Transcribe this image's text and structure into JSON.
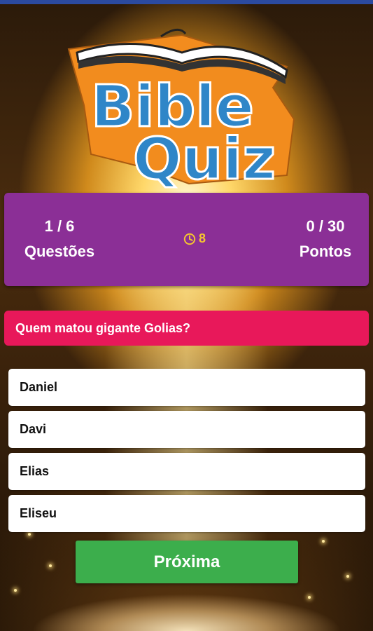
{
  "app": {
    "logo_text": "Bible Quiz",
    "logo_line1": "Bible",
    "logo_line2": "Quiz"
  },
  "score": {
    "question_progress": "1 / 6",
    "question_label": "Questões",
    "timer_value": "8",
    "points_progress": "0 / 30",
    "points_label": "Pontos"
  },
  "question": {
    "text": "Quem matou gigante Golias?"
  },
  "answers": [
    {
      "label": "Daniel"
    },
    {
      "label": "Davi"
    },
    {
      "label": "Elias"
    },
    {
      "label": "Eliseu"
    }
  ],
  "actions": {
    "next_label": "Próxima"
  },
  "colors": {
    "panel": "#8b2f96",
    "question_bg": "#e8185a",
    "button": "#3cae4c",
    "timer": "#f4c430",
    "logo_blue": "#2f86c8",
    "logo_outline": "#f28c1e"
  }
}
